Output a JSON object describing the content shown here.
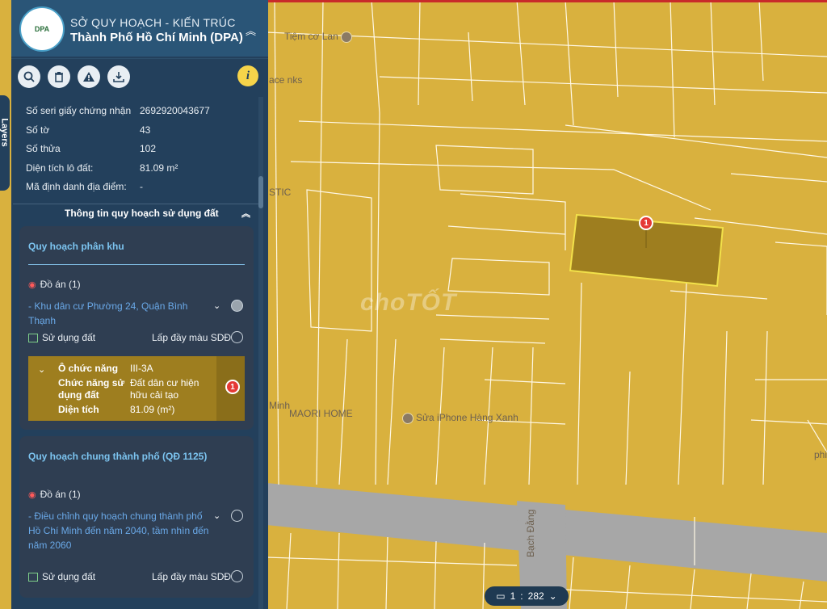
{
  "header": {
    "agency": "SỞ QUY HOẠCH - KIẾN TRÚC",
    "city": "Thành Phố Hồ Chí Minh (DPA)",
    "logo_text": "DPA"
  },
  "toolbar": {
    "icons": [
      "search-icon",
      "trash-icon",
      "warning-icon",
      "download-icon",
      "info-icon"
    ],
    "info_glyph": "i"
  },
  "side_tab": {
    "label": "Layers"
  },
  "properties": [
    {
      "label": "Số seri giấy chứng nhận",
      "value": "2692920043677"
    },
    {
      "label": "Số tờ",
      "value": "43"
    },
    {
      "label": "Số thửa",
      "value": "102"
    },
    {
      "label": "Diện tích lô đất:",
      "value": "81.09 m²"
    },
    {
      "label": "Mã định danh địa điểm:",
      "value": "-"
    }
  ],
  "section": {
    "title": "Thông tin quy hoạch sử dụng đất"
  },
  "zone_plan": {
    "title": "Quy hoạch phân khu",
    "projects_label": "Đồ án (1)",
    "project_link": "- Khu dân cư Phường 24, Quận Bình Thạnh",
    "land_use_label": "Sử dụng đất",
    "fill_label": "Lấp đầy màu SDĐ",
    "detail": {
      "cell_label": "Ô chức năng",
      "cell_value": "III-3A",
      "function_label": "Chức năng sử dụng đất",
      "function_value": "Đất dân cư hiện hữu cải tạo",
      "area_label": "Diện tích",
      "area_value": "81.09 (m²)",
      "badge": "1"
    }
  },
  "city_plan": {
    "title": "Quy hoạch chung thành phố (QĐ 1125)",
    "projects_label": "Đồ án (1)",
    "project_link": "- Điều chỉnh quy hoạch chung thành phố Hồ Chí Minh đến năm 2040, tầm nhìn đến năm 2060",
    "land_use_label": "Sử dụng đất",
    "fill_label": "Lấp đầy màu SDĐ"
  },
  "map": {
    "labels": {
      "poi1": "Tiệm cơ Lan",
      "poi2": "ace nks",
      "poi3": "STIC",
      "poi4": "MAORI HOME",
      "poi5": "Sửa iPhone Hàng Xanh",
      "road": "Bạch Đằng",
      "side": "Minh",
      "edge": "phi"
    },
    "watermark": "choTỐT",
    "marker": "1",
    "scale": {
      "prefix": "1",
      "separator": ":",
      "value": "282"
    },
    "colors": {
      "parcel": "#d9b13e",
      "selected": "#9e7e1f",
      "road": "#a7a7a7",
      "border": "#ffffff"
    }
  }
}
